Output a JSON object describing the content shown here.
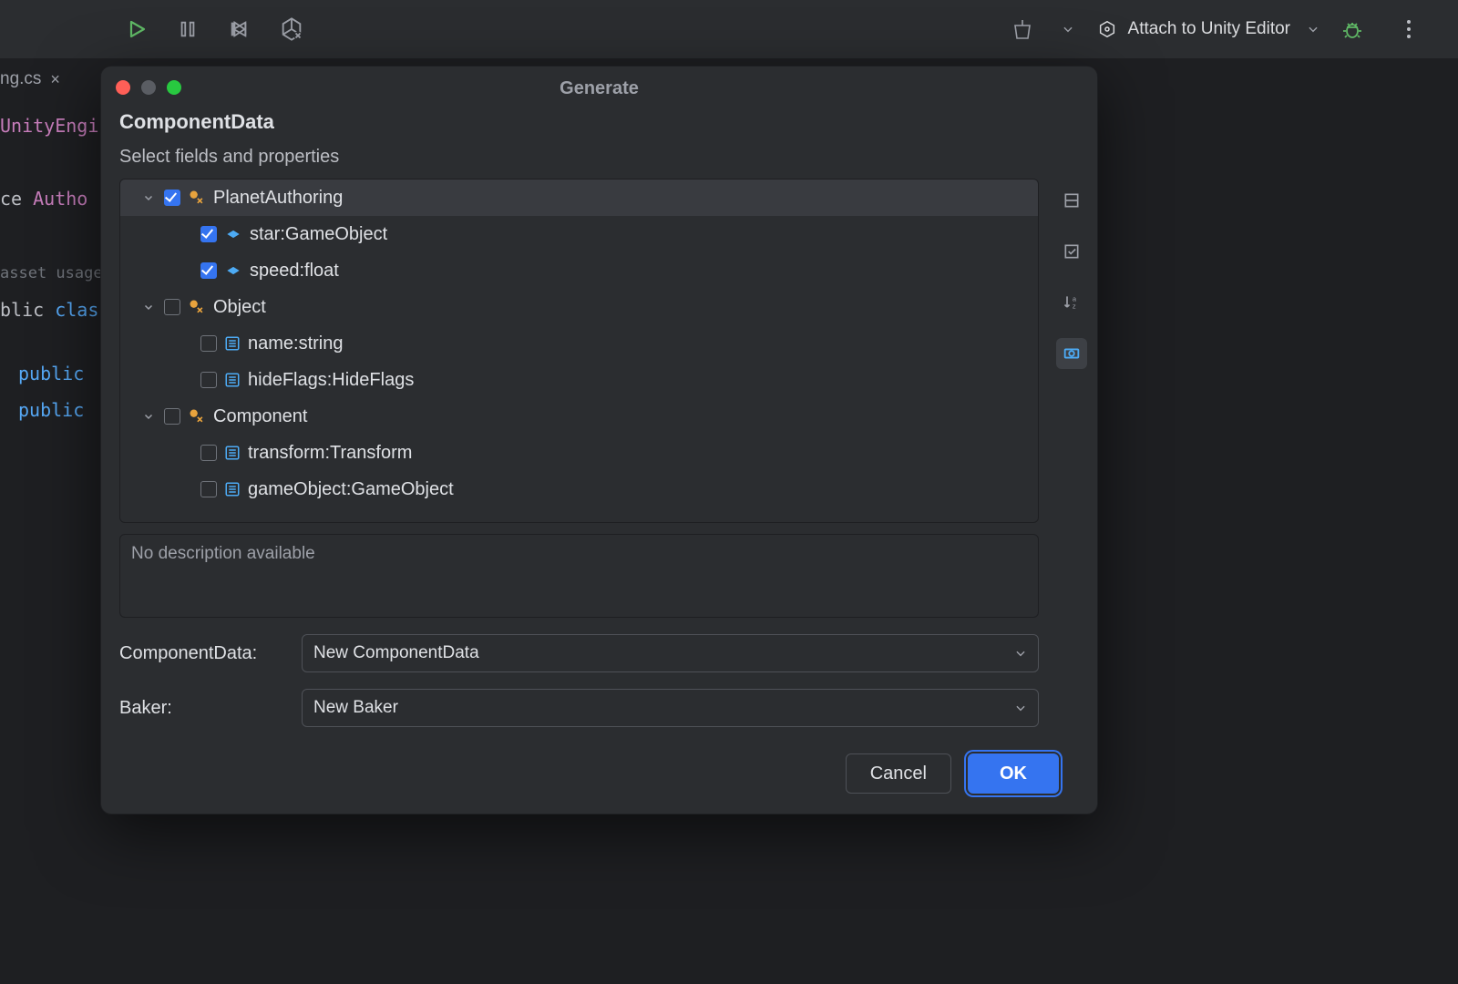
{
  "toolbar": {
    "run_config_label": "Attach to Unity Editor"
  },
  "editor": {
    "tab_name": "ng.cs",
    "lines": {
      "l0": "UnityEngi",
      "l1a": "ce ",
      "l1b": "Autho",
      "l2": "asset usage",
      "l3a": "blic ",
      "l3b": "clas",
      "l4a": "public",
      "l5a": "public"
    }
  },
  "dialog": {
    "title": "Generate",
    "heading": "ComponentData",
    "subheading": "Select fields and properties",
    "tree": {
      "n0": {
        "label": "PlanetAuthoring",
        "checked": true
      },
      "n0_0": {
        "label": "star:GameObject",
        "checked": true
      },
      "n0_1": {
        "label": "speed:float",
        "checked": true
      },
      "n1": {
        "label": "Object",
        "checked": false
      },
      "n1_0": {
        "label": "name:string",
        "checked": false
      },
      "n1_1": {
        "label": "hideFlags:HideFlags",
        "checked": false
      },
      "n2": {
        "label": "Component",
        "checked": false
      },
      "n2_0": {
        "label": "transform:Transform",
        "checked": false
      },
      "n2_1": {
        "label": "gameObject:GameObject",
        "checked": false
      }
    },
    "description": "No description available",
    "form": {
      "component_data_label": "ComponentData:",
      "component_data_value": "New ComponentData",
      "baker_label": "Baker:",
      "baker_value": "New Baker"
    },
    "buttons": {
      "cancel": "Cancel",
      "ok": "OK"
    }
  }
}
